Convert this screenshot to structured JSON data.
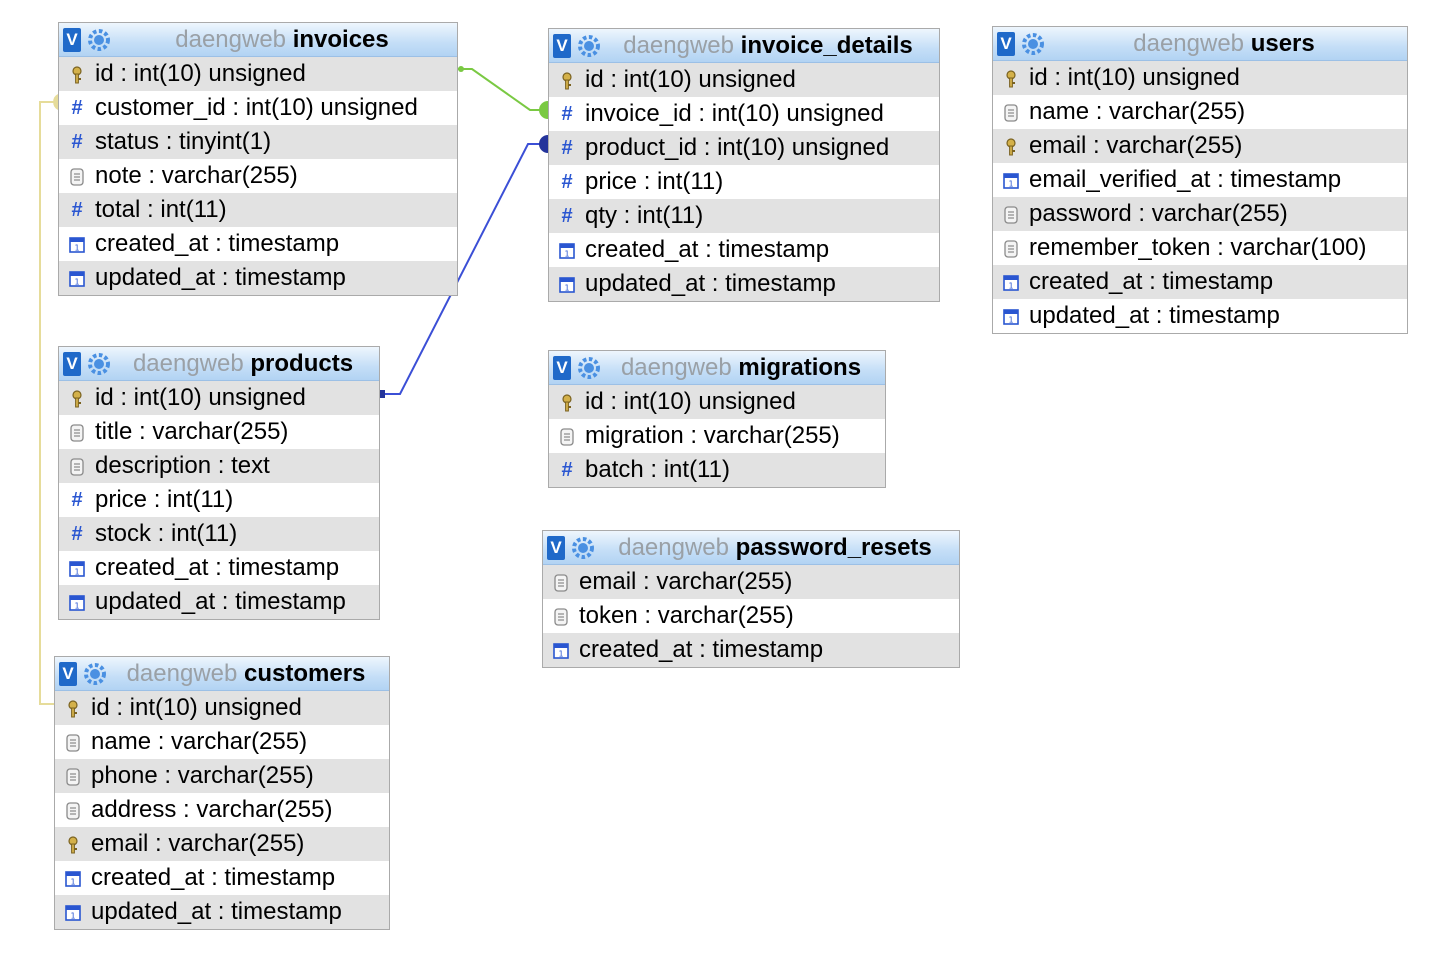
{
  "database": "daengweb",
  "tables": [
    {
      "name": "invoices",
      "columns": [
        {
          "text": "id : int(10) unsigned",
          "icon": "key-icon"
        },
        {
          "text": "customer_id : int(10) unsigned",
          "icon": "hash-icon"
        },
        {
          "text": "status : tinyint(1)",
          "icon": "hash-icon"
        },
        {
          "text": "note : varchar(255)",
          "icon": "text-icon"
        },
        {
          "text": "total : int(11)",
          "icon": "hash-icon"
        },
        {
          "text": "created_at : timestamp",
          "icon": "calendar-icon"
        },
        {
          "text": "updated_at : timestamp",
          "icon": "calendar-icon"
        }
      ]
    },
    {
      "name": "invoice_details",
      "columns": [
        {
          "text": "id : int(10) unsigned",
          "icon": "key-icon"
        },
        {
          "text": "invoice_id : int(10) unsigned",
          "icon": "hash-icon"
        },
        {
          "text": "product_id : int(10) unsigned",
          "icon": "hash-icon"
        },
        {
          "text": "price : int(11)",
          "icon": "hash-icon"
        },
        {
          "text": "qty : int(11)",
          "icon": "hash-icon"
        },
        {
          "text": "created_at : timestamp",
          "icon": "calendar-icon"
        },
        {
          "text": "updated_at : timestamp",
          "icon": "calendar-icon"
        }
      ]
    },
    {
      "name": "users",
      "columns": [
        {
          "text": "id : int(10) unsigned",
          "icon": "key-icon"
        },
        {
          "text": "name : varchar(255)",
          "icon": "text-icon"
        },
        {
          "text": "email : varchar(255)",
          "icon": "key-icon"
        },
        {
          "text": "email_verified_at : timestamp",
          "icon": "calendar-icon"
        },
        {
          "text": "password : varchar(255)",
          "icon": "text-icon"
        },
        {
          "text": "remember_token : varchar(100)",
          "icon": "text-icon"
        },
        {
          "text": "created_at : timestamp",
          "icon": "calendar-icon"
        },
        {
          "text": "updated_at : timestamp",
          "icon": "calendar-icon"
        }
      ]
    },
    {
      "name": "products",
      "columns": [
        {
          "text": "id : int(10) unsigned",
          "icon": "key-icon"
        },
        {
          "text": "title : varchar(255)",
          "icon": "text-icon"
        },
        {
          "text": "description : text",
          "icon": "text-icon"
        },
        {
          "text": "price : int(11)",
          "icon": "hash-icon"
        },
        {
          "text": "stock : int(11)",
          "icon": "hash-icon"
        },
        {
          "text": "created_at : timestamp",
          "icon": "calendar-icon"
        },
        {
          "text": "updated_at : timestamp",
          "icon": "calendar-icon"
        }
      ]
    },
    {
      "name": "migrations",
      "columns": [
        {
          "text": "id : int(10) unsigned",
          "icon": "key-icon"
        },
        {
          "text": "migration : varchar(255)",
          "icon": "text-icon"
        },
        {
          "text": "batch : int(11)",
          "icon": "hash-icon"
        }
      ]
    },
    {
      "name": "password_resets",
      "columns": [
        {
          "text": "email : varchar(255)",
          "icon": "text-icon"
        },
        {
          "text": "token : varchar(255)",
          "icon": "text-icon"
        },
        {
          "text": "created_at : timestamp",
          "icon": "calendar-icon"
        }
      ]
    },
    {
      "name": "customers",
      "columns": [
        {
          "text": "id : int(10) unsigned",
          "icon": "key-icon"
        },
        {
          "text": "name : varchar(255)",
          "icon": "text-icon"
        },
        {
          "text": "phone : varchar(255)",
          "icon": "text-icon"
        },
        {
          "text": "address : varchar(255)",
          "icon": "text-icon"
        },
        {
          "text": "email : varchar(255)",
          "icon": "key-icon"
        },
        {
          "text": "created_at : timestamp",
          "icon": "calendar-icon"
        },
        {
          "text": "updated_at : timestamp",
          "icon": "calendar-icon"
        }
      ]
    }
  ],
  "relations": [
    {
      "from": "invoice_details.invoice_id",
      "to": "invoices.id",
      "color": "#7ac943"
    },
    {
      "from": "invoice_details.product_id",
      "to": "products.id",
      "color": "#3b4fd6"
    },
    {
      "from": "invoices.customer_id",
      "to": "customers.id",
      "color": "#e6dc9a"
    }
  ]
}
